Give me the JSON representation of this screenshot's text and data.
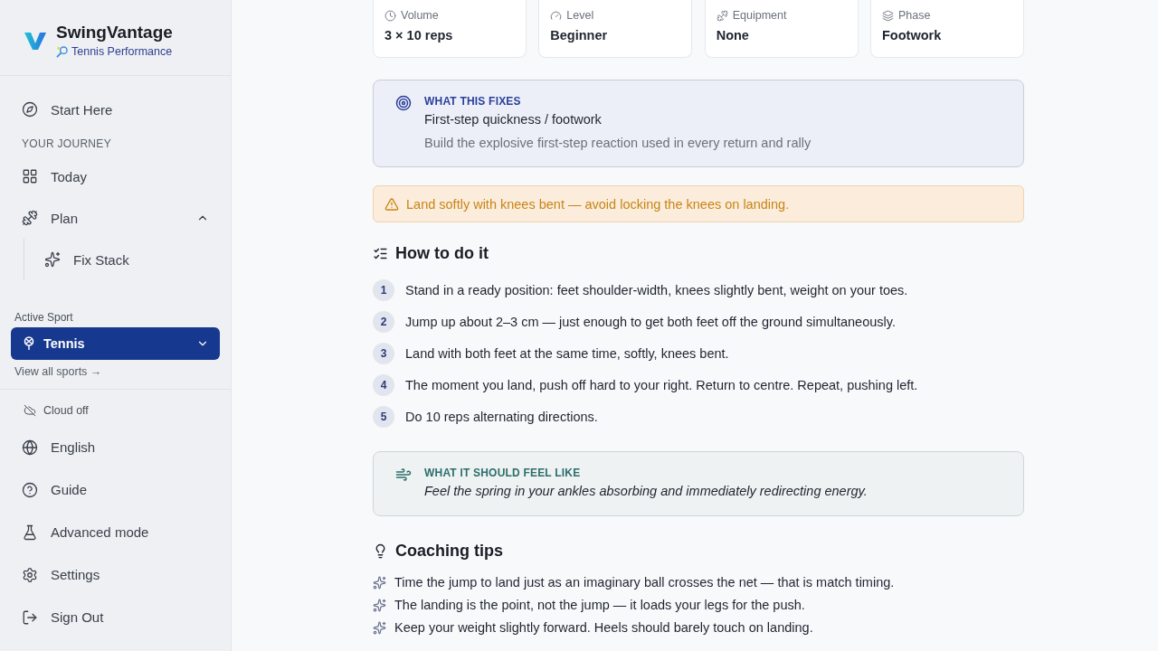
{
  "brand": {
    "name": "SwingVantage",
    "subtitle": "Tennis Performance"
  },
  "sidebar": {
    "start": {
      "label": "Start Here"
    },
    "section_label": "YOUR JOURNEY",
    "items": [
      {
        "label": "Today"
      },
      {
        "label": "Plan",
        "expanded": true,
        "children": [
          {
            "label": "Fix Stack"
          }
        ]
      }
    ],
    "active_sport": {
      "label": "Active Sport",
      "value": "Tennis",
      "link": "View all sports →"
    },
    "sync_status": "Cloud off",
    "footer": [
      {
        "label": "English"
      },
      {
        "label": "Guide"
      },
      {
        "label": "Advanced mode"
      },
      {
        "label": "Settings"
      },
      {
        "label": "Sign Out"
      }
    ]
  },
  "stats": [
    {
      "label": "Volume",
      "value": "3 × 10 reps"
    },
    {
      "label": "Level",
      "value": "Beginner"
    },
    {
      "label": "Equipment",
      "value": "None"
    },
    {
      "label": "Phase",
      "value": "Footwork"
    }
  ],
  "fixes": {
    "heading": "WHAT THIS FIXES",
    "title": "First-step quickness / footwork",
    "description": "Build the explosive first-step reaction used in every return and rally"
  },
  "warning": "Land softly with knees bent — avoid locking the knees on landing.",
  "steps": {
    "heading": "How to do it",
    "items": [
      {
        "number": "1",
        "text": "Stand in a ready position: feet shoulder-width, knees slightly bent, weight on your toes."
      },
      {
        "number": "2",
        "text": "Jump up about 2–3 cm — just enough to get both feet off the ground simultaneously."
      },
      {
        "number": "3",
        "text": "Land with both feet at the same time, softly, knees bent."
      },
      {
        "number": "4",
        "text": "The moment you land, push off hard to your right. Return to centre. Repeat, pushing left."
      },
      {
        "number": "5",
        "text": "Do 10 reps alternating directions."
      }
    ]
  },
  "feel": {
    "heading": "WHAT IT SHOULD FEEL LIKE",
    "text": "Feel the spring in your ankles absorbing and immediately redirecting energy."
  },
  "tips": {
    "heading": "Coaching tips",
    "items": [
      "Time the jump to land just as an imaginary ball crosses the net — that is match timing.",
      "The landing is the point, not the jump — it loads your legs for the push.",
      "Keep your weight slightly forward. Heels should barely touch on landing."
    ]
  }
}
